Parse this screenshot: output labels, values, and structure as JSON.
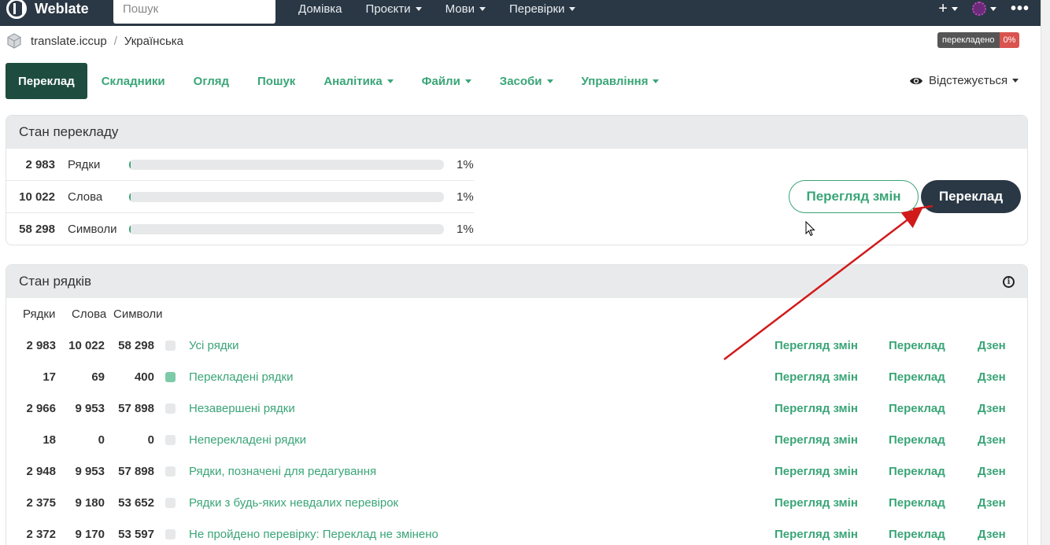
{
  "navbar": {
    "brand": "Weblate",
    "search_placeholder": "Пошук",
    "links": [
      {
        "label": "Домівка",
        "dropdown": false
      },
      {
        "label": "Проєкти",
        "dropdown": true
      },
      {
        "label": "Мови",
        "dropdown": true
      },
      {
        "label": "Перевірки",
        "dropdown": true
      }
    ],
    "icons": [
      "plus-icon",
      "avatar-icon",
      "more-icon"
    ]
  },
  "breadcrumb": {
    "project": "translate.iccup",
    "separator": "/",
    "language": "Українська"
  },
  "progress_badge": {
    "label": "перекладено",
    "value": "0%"
  },
  "tabs": [
    {
      "label": "Переклад",
      "active": true,
      "dropdown": false
    },
    {
      "label": "Складники",
      "active": false,
      "dropdown": false
    },
    {
      "label": "Огляд",
      "active": false,
      "dropdown": false
    },
    {
      "label": "Пошук",
      "active": false,
      "dropdown": false
    },
    {
      "label": "Аналітика",
      "active": false,
      "dropdown": true
    },
    {
      "label": "Файли",
      "active": false,
      "dropdown": true
    },
    {
      "label": "Засоби",
      "active": false,
      "dropdown": true
    },
    {
      "label": "Управління",
      "active": false,
      "dropdown": true
    }
  ],
  "watch": {
    "label": "Відстежується"
  },
  "translation_status": {
    "title": "Стан перекладу",
    "rows": [
      {
        "count": "2 983",
        "label": "Рядки",
        "percent": "1%",
        "fill": 0.006
      },
      {
        "count": "10 022",
        "label": "Слова",
        "percent": "1%",
        "fill": 0.006
      },
      {
        "count": "58 298",
        "label": "Символи",
        "percent": "1%",
        "fill": 0.006
      }
    ],
    "buttons": {
      "changes": "Перегляд змін",
      "translate": "Переклад"
    }
  },
  "string_status": {
    "title": "Стан рядків",
    "columns": [
      "Рядки",
      "Слова",
      "Символи"
    ],
    "rows": [
      {
        "strings": "2 983",
        "words": "10 022",
        "chars": "58 298",
        "label": "Усі рядки",
        "filled": false
      },
      {
        "strings": "17",
        "words": "69",
        "chars": "400",
        "label": "Перекладені рядки",
        "filled": true
      },
      {
        "strings": "2 966",
        "words": "9 953",
        "chars": "57 898",
        "label": "Незавершені рядки",
        "filled": false
      },
      {
        "strings": "18",
        "words": "0",
        "chars": "0",
        "label": "Неперекладені рядки",
        "filled": false
      },
      {
        "strings": "2 948",
        "words": "9 953",
        "chars": "57 898",
        "label": "Рядки, позначені для редагування",
        "filled": false
      },
      {
        "strings": "2 375",
        "words": "9 180",
        "chars": "53 652",
        "label": "Рядки з будь-яких невдалих перевірок",
        "filled": false
      },
      {
        "strings": "2 372",
        "words": "9 170",
        "chars": "53 597",
        "label": "Не пройдено перевірку: Переклад не змінено",
        "filled": false
      }
    ],
    "actions": [
      "Перегляд змін",
      "Переклад",
      "Дзен"
    ]
  },
  "colors": {
    "navbar_bg": "#2a3744",
    "accent": "#3aa577",
    "active_tab": "#1e4d40",
    "badge_red": "#d9534f",
    "annotation_arrow": "#d11a1a"
  }
}
